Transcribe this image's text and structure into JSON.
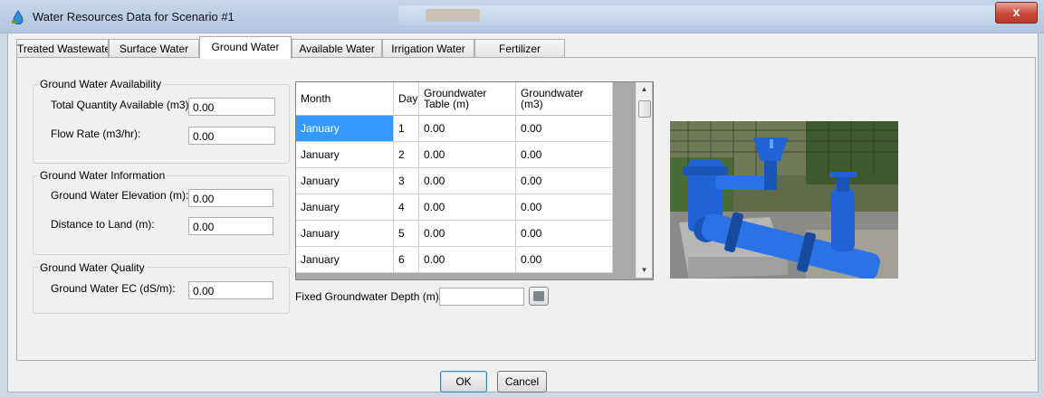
{
  "window": {
    "title": "Water Resources Data for Scenario #1",
    "close_glyph": "x"
  },
  "tabs": [
    {
      "label": "Treated Wastewate",
      "active": false
    },
    {
      "label": "Surface Water",
      "active": false
    },
    {
      "label": "Ground Water",
      "active": true
    },
    {
      "label": "Available Water",
      "active": false
    },
    {
      "label": "Irrigation Water",
      "active": false
    },
    {
      "label": "Fertilizer",
      "active": false
    }
  ],
  "availability": {
    "title": "Ground Water Availability",
    "total_label": "Total Quantity Available (m3):",
    "total_value": "0.00",
    "flow_label": "Flow Rate (m3/hr):",
    "flow_value": "0.00"
  },
  "information": {
    "title": "Ground Water Information",
    "elevation_label": "Ground Water Elevation (m):",
    "elevation_value": "0.00",
    "distance_label": "Distance to Land (m):",
    "distance_value": "0.00"
  },
  "quality": {
    "title": "Ground Water Quality",
    "ec_label": "Ground Water EC (dS/m):",
    "ec_value": "0.00"
  },
  "grid": {
    "columns": [
      "Month",
      "Day",
      "Groundwater Table (m)",
      "Groundwater (m3)"
    ],
    "rows": [
      [
        "January",
        "1",
        "0.00",
        "0.00"
      ],
      [
        "January",
        "2",
        "0.00",
        "0.00"
      ],
      [
        "January",
        "3",
        "0.00",
        "0.00"
      ],
      [
        "January",
        "4",
        "0.00",
        "0.00"
      ],
      [
        "January",
        "5",
        "0.00",
        "0.00"
      ],
      [
        "January",
        "6",
        "0.00",
        "0.00"
      ]
    ]
  },
  "fixed_depth": {
    "label": "Fixed Groundwater Depth (m):",
    "value": ""
  },
  "buttons": {
    "ok": "OK",
    "cancel": "Cancel"
  },
  "icons": {
    "app": "water-drop-icon",
    "scroll_up": "scroll-up-arrow-icon",
    "scroll_down": "scroll-down-arrow-icon",
    "depth_button": "table-icon"
  },
  "colors": {
    "selection": "#3399ff",
    "pump_blue": "#1f63d6",
    "title_bar": "#c7d6ea",
    "close_red": "#c94a3b"
  }
}
